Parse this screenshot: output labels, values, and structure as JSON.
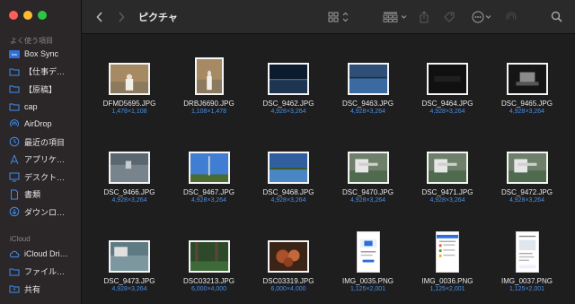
{
  "window": {
    "title": "ピクチャ"
  },
  "sidebar": {
    "favorites_title": "よく使う項目",
    "favorites": [
      {
        "label": "Box Sync",
        "icon": "box-logo-icon"
      },
      {
        "label": "【仕事デ…",
        "icon": "folder-icon"
      },
      {
        "label": "【原稿】",
        "icon": "folder-icon"
      },
      {
        "label": "cap",
        "icon": "folder-icon"
      },
      {
        "label": "AirDrop",
        "icon": "airdrop-icon"
      },
      {
        "label": "最近の項目",
        "icon": "clock-icon"
      },
      {
        "label": "アプリケ…",
        "icon": "applications-icon"
      },
      {
        "label": "デスクト…",
        "icon": "desktop-icon"
      },
      {
        "label": "書類",
        "icon": "document-icon"
      },
      {
        "label": "ダウンロ…",
        "icon": "download-icon"
      }
    ],
    "icloud_title": "iCloud",
    "icloud": [
      {
        "label": "iCloud Dri…",
        "icon": "cloud-icon"
      },
      {
        "label": "ファイル…",
        "icon": "folder-icon"
      },
      {
        "label": "共有",
        "icon": "shared-folder-icon"
      }
    ]
  },
  "files": [
    {
      "name": "DFMD5695.JPG",
      "dims": "1,478×1,108",
      "shape": "h",
      "kind": "portrait-photo"
    },
    {
      "name": "DRBJ6690.JPG",
      "dims": "1,108×1,478",
      "shape": "v",
      "kind": "portrait-photo"
    },
    {
      "name": "DSC_9462.JPG",
      "dims": "4,928×3,264",
      "shape": "h",
      "kind": "dark-water"
    },
    {
      "name": "DSC_9463.JPG",
      "dims": "4,928×3,264",
      "shape": "h",
      "kind": "blue-water"
    },
    {
      "name": "DSC_9464.JPG",
      "dims": "4,928×3,264",
      "shape": "h",
      "kind": "dark"
    },
    {
      "name": "DSC_9465.JPG",
      "dims": "4,928×3,264",
      "shape": "h",
      "kind": "dark-machine"
    },
    {
      "name": "DSC_9466.JPG",
      "dims": "4,928×3,264",
      "shape": "h",
      "kind": "gray-water"
    },
    {
      "name": "DSC_9467.JPG",
      "dims": "4,928×3,264",
      "shape": "h",
      "kind": "sky-pole"
    },
    {
      "name": "DSC_9468.JPG",
      "dims": "4,928×3,264",
      "shape": "h",
      "kind": "blue-field"
    },
    {
      "name": "DSC_9470.JPG",
      "dims": "4,928×3,264",
      "shape": "h",
      "kind": "machine"
    },
    {
      "name": "DSC_9471.JPG",
      "dims": "4,928×3,264",
      "shape": "h",
      "kind": "machine"
    },
    {
      "name": "DSC_9472.JPG",
      "dims": "4,928×3,264",
      "shape": "h",
      "kind": "machine"
    },
    {
      "name": "DSC_9473.JPG",
      "dims": "4,928×3,264",
      "shape": "h",
      "kind": "water-machine"
    },
    {
      "name": "DSC03213.JPG",
      "dims": "6,000×4,000",
      "shape": "h",
      "kind": "forest"
    },
    {
      "name": "DSC03319.JPG",
      "dims": "6,000×4,000",
      "shape": "h",
      "kind": "food"
    },
    {
      "name": "IMG_0035.PNG",
      "dims": "1,125×2,001",
      "shape": "p",
      "kind": "screen-a"
    },
    {
      "name": "IMG_0036.PNG",
      "dims": "1,125×2,001",
      "shape": "p",
      "kind": "screen-b"
    },
    {
      "name": "IMG_0037.PNG",
      "dims": "1,125×2,001",
      "shape": "p",
      "kind": "screen-c"
    }
  ],
  "colors": {
    "accent": "#4a8de8",
    "sidebar_bg": "#2b2729",
    "content_bg": "#1e1e1e"
  }
}
